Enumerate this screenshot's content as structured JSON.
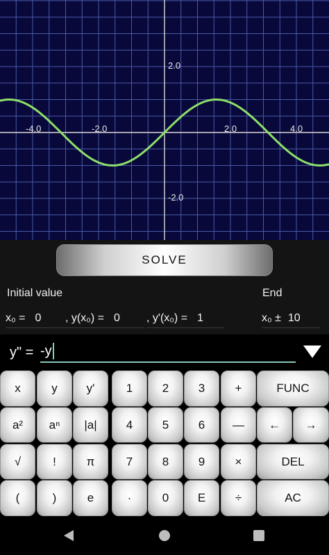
{
  "graph": {
    "x_ticks": [
      "-4.0",
      "-2.0",
      "2.0",
      "4.0"
    ],
    "y_ticks": [
      "2.0",
      "-2.0"
    ],
    "curve_color": "#8ee06a",
    "grid_color": "#4a5aa8",
    "axis_color": "#d8d8d8"
  },
  "solve_label": "SOLVE",
  "labels": {
    "initial_value": "Initial value",
    "end": "End"
  },
  "fields": {
    "x0_label": "x₀ =",
    "x0_value": "0",
    "yx0_label": ", y(x₀) =",
    "yx0_value": "0",
    "dyx0_label": ", y'(x₀) =",
    "dyx0_value": "1",
    "end_label": "x₀ ±",
    "end_value": "10"
  },
  "equation": {
    "label": "y\" =",
    "value": "-y"
  },
  "keys": [
    "x",
    "y",
    "y'",
    "1",
    "2",
    "3",
    "+",
    "FUNC",
    "a²",
    "aⁿ",
    "|a|",
    "4",
    "5",
    "6",
    "—",
    "←",
    "→",
    "√",
    "!",
    "π",
    "7",
    "8",
    "9",
    "×",
    "DEL",
    "(",
    ")",
    "e",
    "·",
    "0",
    "E",
    "÷",
    "AC"
  ]
}
